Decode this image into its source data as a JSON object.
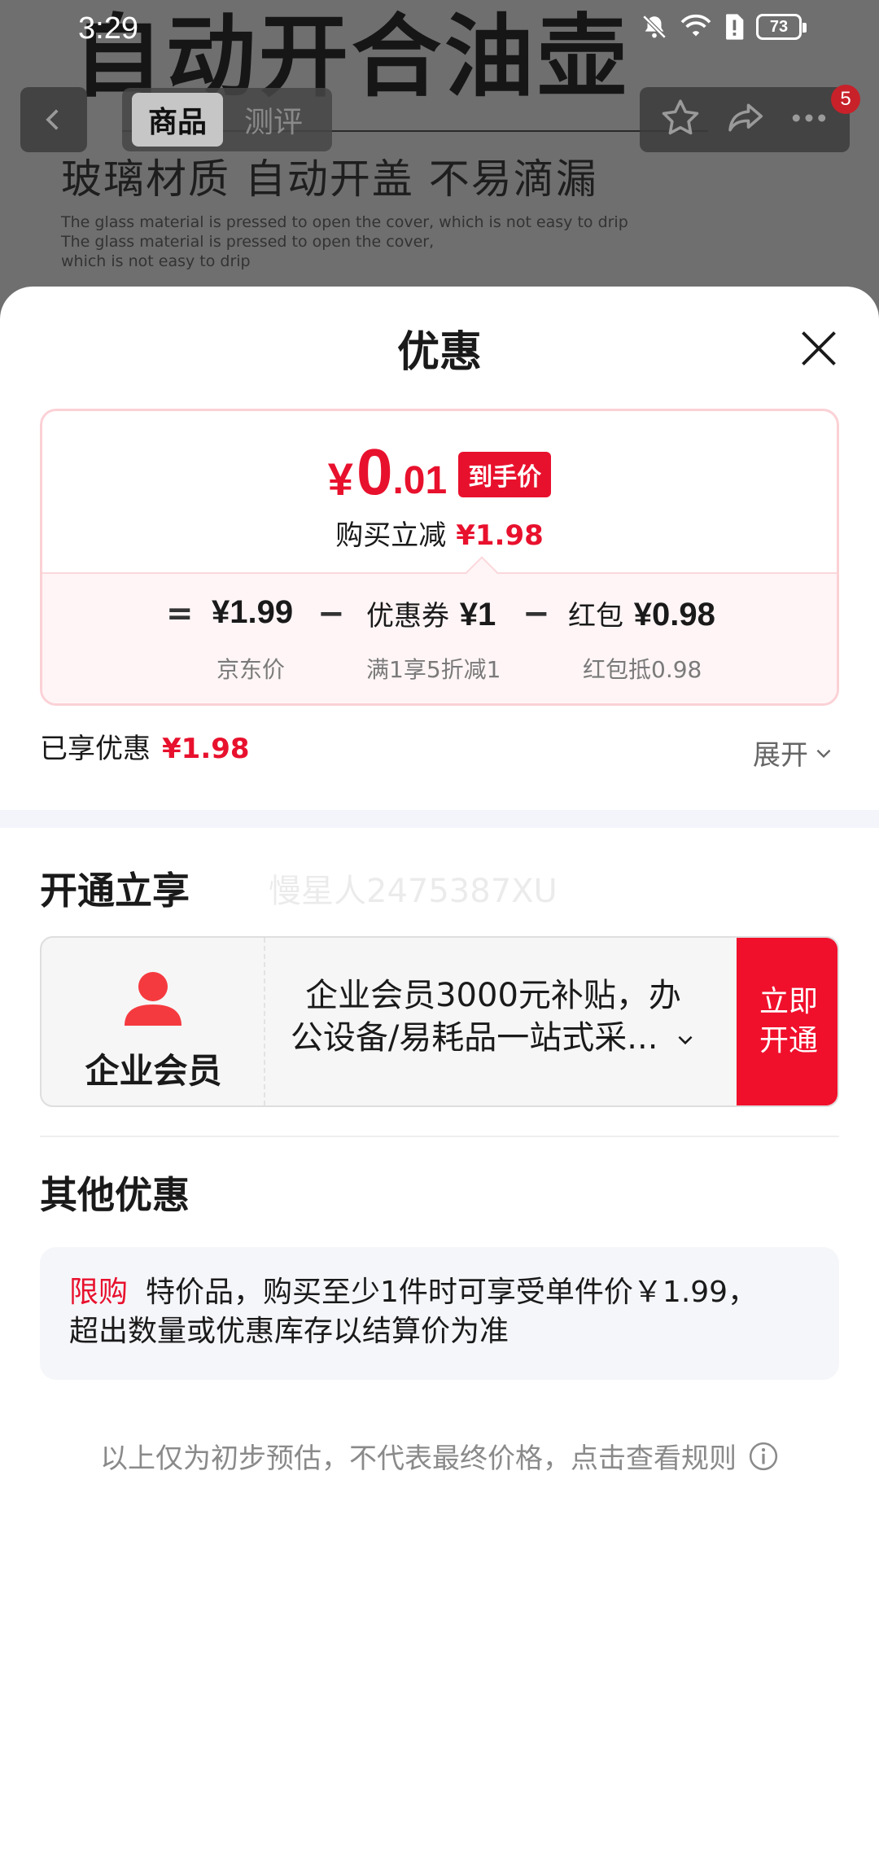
{
  "status_bar": {
    "time": "3:29",
    "battery": "73"
  },
  "background": {
    "banner_title": "自动开合油壶",
    "banner_subtitle": "玻璃材质 自动开盖 不易滴漏",
    "banner_english": [
      "The glass material is pressed  to open the cover, which is not easy to drip",
      "The glass material is pressed  to open the cover,",
      "which is not easy to drip"
    ]
  },
  "top_nav": {
    "tabs": [
      "商品",
      "测评"
    ],
    "active_tab": 0,
    "message_badge": "5"
  },
  "sheet": {
    "title": "优惠",
    "price_card": {
      "currency": "¥",
      "final_int": "0",
      "final_dec": ".01",
      "final_tag": "到手价",
      "reduce_label": "购买立减",
      "reduce_amount": "¥1.98",
      "equals": "=",
      "minus": "−",
      "jd_price": "¥1.99",
      "jd_price_label": "京东价",
      "coupon_label": "优惠券",
      "coupon_amount": "¥1",
      "coupon_sub": "满1享5折减1",
      "redpacket_label": "红包",
      "redpacket_amount": "¥0.98",
      "redpacket_sub": "红包抵0.98"
    },
    "enjoyed_label": "已享优惠",
    "enjoyed_amount": "¥1.98",
    "expand_label": "展开",
    "open_section_title": "开通立享",
    "watermark": "慢星人2475387XU",
    "member": {
      "name": "企业会员",
      "desc_line1": "企业会员3000元补贴，办",
      "desc_line2": "公设备/易耗品一站式采...",
      "button_line1": "立即",
      "button_line2": "开通"
    },
    "other_section_title": "其他优惠",
    "limit": {
      "tag": "限购",
      "line1": "特价品，购买至少1件时可享受单件价￥1.99，",
      "line2": "超出数量或优惠库存以结算价为准"
    },
    "disclaimer": "以上仅为初步预估，不代表最终价格，点击查看规则"
  },
  "colors": {
    "accent_red": "#e8112d",
    "button_red": "#f0102c",
    "card_border": "#fbd1d6"
  }
}
